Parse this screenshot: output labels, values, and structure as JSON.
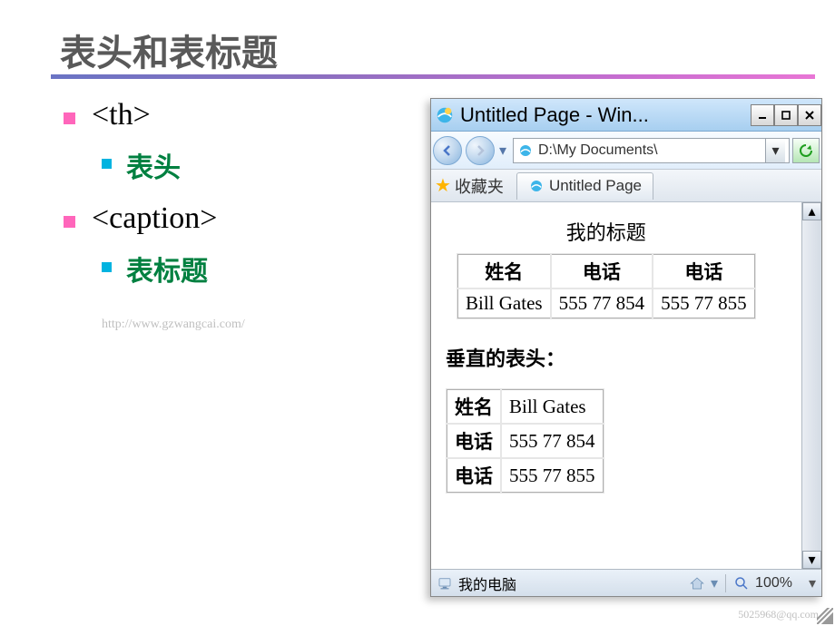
{
  "slide": {
    "title": "表头和表标题",
    "bullets": [
      {
        "tag": "<th>",
        "sub": "表头"
      },
      {
        "tag": "<caption>",
        "sub": "表标题"
      }
    ],
    "url_watermark": "http://www.gzwangcai.com/"
  },
  "browser": {
    "window_title": "Untitled Page - Win...",
    "address": "D:\\My Documents\\",
    "favorites_label": "收藏夹",
    "tab_label": "Untitled Page",
    "status_computer": "我的电脑",
    "zoom": "100%"
  },
  "page": {
    "table1": {
      "caption": "我的标题",
      "headers": [
        "姓名",
        "电话",
        "电话"
      ],
      "row": [
        "Bill Gates",
        "555 77 854",
        "555 77 855"
      ]
    },
    "section_title": "垂直的表头：",
    "table2": {
      "rows": [
        {
          "th": "姓名",
          "td": "Bill Gates"
        },
        {
          "th": "电话",
          "td": "555 77 854"
        },
        {
          "th": "电话",
          "td": "555 77 855"
        }
      ]
    }
  },
  "credits": {
    "line2": "5025968@qq.com"
  }
}
